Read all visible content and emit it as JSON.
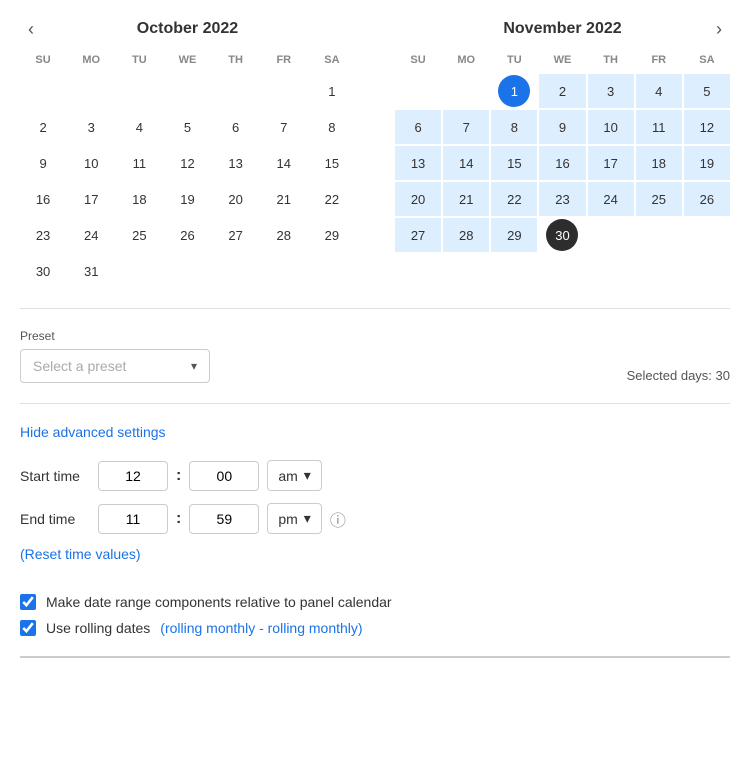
{
  "header": {
    "left_nav": "‹",
    "right_nav": "›"
  },
  "october": {
    "month": "October",
    "year": "2022",
    "days_of_week": [
      "SU",
      "MO",
      "TU",
      "WE",
      "TH",
      "FR",
      "SA"
    ],
    "weeks": [
      [
        null,
        null,
        null,
        null,
        null,
        null,
        1
      ],
      [
        2,
        3,
        4,
        5,
        6,
        7,
        8
      ],
      [
        9,
        10,
        11,
        12,
        13,
        14,
        15
      ],
      [
        16,
        17,
        18,
        19,
        20,
        21,
        22
      ],
      [
        23,
        24,
        25,
        26,
        27,
        28,
        29
      ],
      [
        30,
        31,
        null,
        null,
        null,
        null,
        null
      ]
    ]
  },
  "november": {
    "month": "November",
    "year": "2022",
    "days_of_week": [
      "SU",
      "MO",
      "TU",
      "WE",
      "TH",
      "FR",
      "SA"
    ],
    "weeks": [
      [
        null,
        null,
        1,
        2,
        3,
        4,
        5
      ],
      [
        6,
        7,
        8,
        9,
        10,
        11,
        12
      ],
      [
        13,
        14,
        15,
        16,
        17,
        18,
        19
      ],
      [
        20,
        21,
        22,
        23,
        24,
        25,
        26
      ],
      [
        27,
        28,
        29,
        30,
        null,
        null,
        null
      ]
    ]
  },
  "preset": {
    "label": "Preset",
    "placeholder": "Select a preset",
    "selected_days_label": "Selected days: 30"
  },
  "advanced": {
    "hide_label": "Hide advanced settings",
    "start_time_label": "Start time",
    "start_hour": "12",
    "start_minute": "00",
    "start_ampm": "am",
    "end_time_label": "End time",
    "end_hour": "11",
    "end_minute": "59",
    "end_ampm": "pm",
    "reset_label": "(Reset time values)",
    "check1_label": "Make date range components relative to panel calendar",
    "check2_label": "Use rolling dates",
    "rolling_text": "(rolling monthly - rolling monthly)"
  }
}
